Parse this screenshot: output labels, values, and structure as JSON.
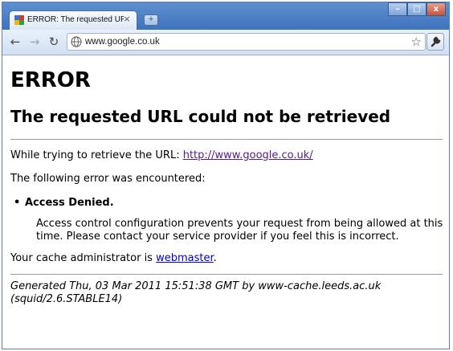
{
  "tab": {
    "title": "ERROR: The requested UR...",
    "close_glyph": "×"
  },
  "new_tab_glyph": "+",
  "window_buttons": {
    "minimize": "–",
    "maximize": "□",
    "close": "x"
  },
  "toolbar": {
    "back_glyph": "←",
    "forward_glyph": "→",
    "reload_glyph": "↻",
    "star_glyph": "☆"
  },
  "omnibox": {
    "value": "www.google.co.uk"
  },
  "page": {
    "heading": "ERROR",
    "subheading": "The requested URL could not be retrieved",
    "retrieve_prefix": "While trying to retrieve the URL: ",
    "retrieve_url": "http://www.google.co.uk/",
    "error_intro": "The following error was encountered:",
    "error_title": "Access Denied.",
    "error_detail": "Access control configuration prevents your request from being allowed at this time. Please contact your service provider if you feel this is incorrect.",
    "admin_prefix": "Your cache administrator is ",
    "admin_link": "webmaster",
    "admin_suffix": ".",
    "generated": "Generated Thu, 03 Mar 2011 15:51:38 GMT by www-cache.leeds.ac.uk (squid/2.6.STABLE14)"
  },
  "colors": {
    "titlebar": "#4a7fc4",
    "visited_link": "#551a8b",
    "link": "#0000cc"
  }
}
